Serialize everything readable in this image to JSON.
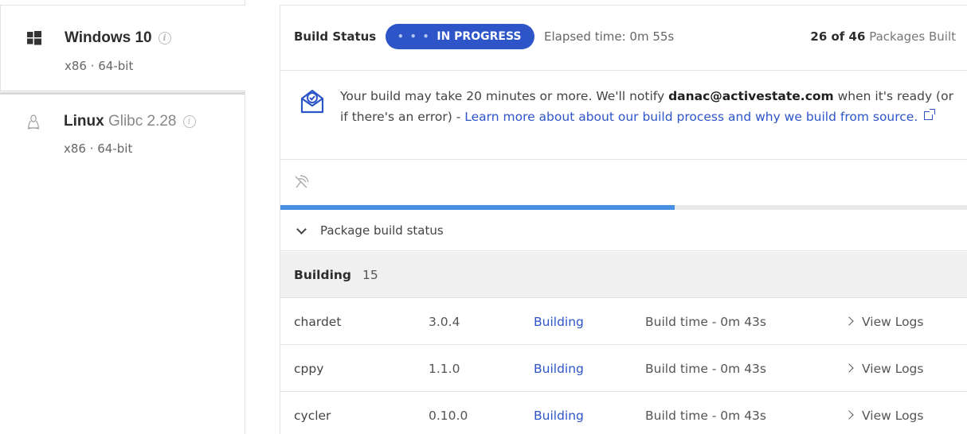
{
  "platforms": [
    {
      "name": "Windows 10",
      "version": "",
      "arch": "x86 · 64-bit",
      "icon": "windows-icon",
      "active": true
    },
    {
      "name": "Linux",
      "version": "Glibc 2.28",
      "arch": "x86 · 64-bit",
      "icon": "linux-penguin-icon",
      "active": false
    }
  ],
  "build_status": {
    "label": "Build Status",
    "state": "IN PROGRESS",
    "dots": "• • •",
    "elapsed_label": "Elapsed time:",
    "elapsed_value": "0m 55s",
    "packages_built": "26 of 46",
    "packages_suffix": "Packages Built",
    "progress_fraction": 0.5625,
    "accent_color": "#2d55c8"
  },
  "notice": {
    "icon": "mail-check-icon",
    "text_before": "Your build may take 20 minutes or more. We'll notify ",
    "email": "danac@activestate.com",
    "text_after": " when it's ready (or if there's an error) - ",
    "link_text": "Learn more about about our build process and why we build from source.",
    "link_icon": "external-link-icon"
  },
  "log_row": {
    "icon": "no-signal-icon"
  },
  "package_section": {
    "toggle_label": "Package build status",
    "group_title": "Building",
    "group_count": "15",
    "rows": [
      {
        "name": "chardet",
        "version": "3.0.4",
        "status": "Building",
        "time": "Build time - 0m 43s",
        "action": "View Logs"
      },
      {
        "name": "cppy",
        "version": "1.1.0",
        "status": "Building",
        "time": "Build time - 0m 43s",
        "action": "View Logs"
      },
      {
        "name": "cycler",
        "version": "0.10.0",
        "status": "Building",
        "time": "Build time - 0m 43s",
        "action": "View Logs"
      }
    ]
  }
}
